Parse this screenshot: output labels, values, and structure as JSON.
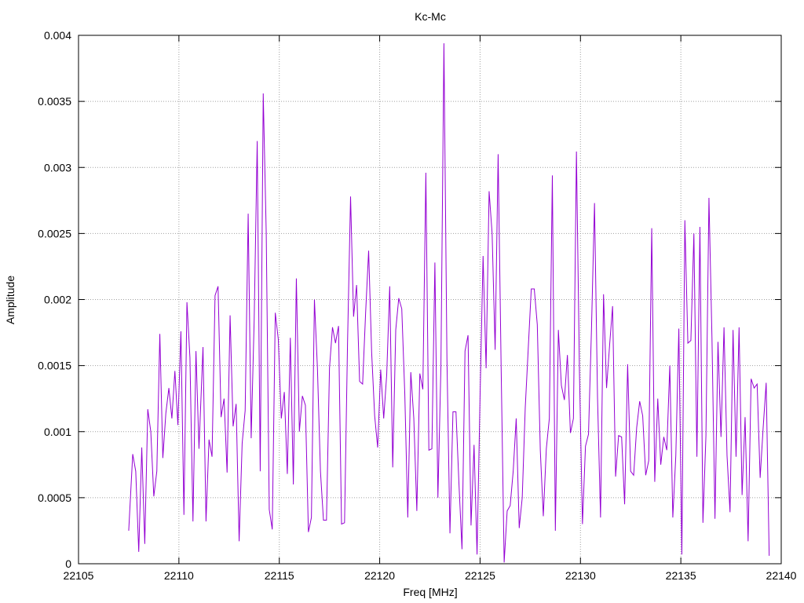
{
  "chart_data": {
    "type": "line",
    "title": "Kc-Mc",
    "xlabel": "Freq [MHz]",
    "ylabel": "Amplitude",
    "xlim": [
      22105,
      22140
    ],
    "ylim": [
      0,
      0.004
    ],
    "grid": true,
    "xticks": [
      22105,
      22110,
      22115,
      22120,
      22125,
      22130,
      22135,
      22140
    ],
    "yticks": [
      0,
      0.0005,
      0.001,
      0.0015,
      0.002,
      0.0025,
      0.003,
      0.0035,
      0.004
    ],
    "xtick_labels": [
      "22105",
      "22110",
      "22115",
      "22120",
      "22125",
      "22130",
      "22135",
      "22140"
    ],
    "ytick_labels": [
      "0",
      "0.0005",
      "0.001",
      "0.0015",
      "0.002",
      "0.0025",
      "0.003",
      "0.0035",
      "0.004"
    ],
    "series_color": "#9400d3",
    "series": [
      {
        "x": [
          22107.5,
          22107.7,
          22107.85,
          22108,
          22108.15,
          22108.3,
          22108.45,
          22108.6,
          22108.75,
          22108.9,
          22109.05,
          22109.2,
          22109.35,
          22109.5,
          22109.65,
          22109.8,
          22109.95,
          22110.1,
          22110.25,
          22110.4,
          22110.55,
          22110.7,
          22110.85,
          22111,
          22111.2,
          22111.35,
          22111.5,
          22111.65,
          22111.8,
          22111.95,
          22112.1,
          22112.25,
          22112.4,
          22112.55,
          22112.7,
          22112.85,
          22113,
          22113.15,
          22113.3,
          22113.45,
          22113.6,
          22113.75,
          22113.9,
          22114.05,
          22114.2,
          22114.35,
          22114.5,
          22114.65,
          22114.8,
          22114.95,
          22115.1,
          22115.25,
          22115.4,
          22115.55,
          22115.7,
          22115.85,
          22116,
          22116.15,
          22116.3,
          22116.45,
          22116.6,
          22116.75,
          22116.9,
          22117.05,
          22117.2,
          22117.35,
          22117.5,
          22117.65,
          22117.8,
          22117.95,
          22118.1,
          22118.25,
          22118.4,
          22118.55,
          22118.7,
          22118.85,
          22119,
          22119.15,
          22119.3,
          22119.45,
          22119.6,
          22119.75,
          22119.9,
          22120.05,
          22120.2,
          22120.35,
          22120.5,
          22120.65,
          22120.8,
          22120.95,
          22121.1,
          22121.25,
          22121.4,
          22121.55,
          22121.7,
          22121.85,
          22122,
          22122.15,
          22122.3,
          22122.45,
          22122.6,
          22122.75,
          22122.9,
          22123.05,
          22123.2,
          22123.35,
          22123.5,
          22123.65,
          22123.8,
          22123.95,
          22124.1,
          22124.25,
          22124.4,
          22124.55,
          22124.7,
          22124.85,
          22125,
          22125.15,
          22125.3,
          22125.45,
          22125.6,
          22125.75,
          22125.9,
          22126.05,
          22126.2,
          22126.35,
          22126.5,
          22126.65,
          22126.8,
          22126.95,
          22127.1,
          22127.25,
          22127.4,
          22127.55,
          22127.7,
          22127.85,
          22128,
          22128.15,
          22128.3,
          22128.45,
          22128.6,
          22128.75,
          22128.9,
          22129.05,
          22129.2,
          22129.35,
          22129.5,
          22129.65,
          22129.8,
          22129.95,
          22130.1,
          22130.25,
          22130.4,
          22130.55,
          22130.7,
          22130.85,
          22131,
          22131.15,
          22131.3,
          22131.45,
          22131.6,
          22131.75,
          22131.9,
          22132.05,
          22132.2,
          22132.35,
          22132.5,
          22132.65,
          22132.8,
          22132.95,
          22133.1,
          22133.25,
          22133.4,
          22133.55,
          22133.7,
          22133.85,
          22134,
          22134.15,
          22134.3,
          22134.45,
          22134.6,
          22134.75,
          22134.9,
          22135.05,
          22135.2,
          22135.35,
          22135.5,
          22135.65,
          22135.8,
          22135.95,
          22136.1,
          22136.25,
          22136.4,
          22136.55,
          22136.7,
          22136.85,
          22137,
          22137.15,
          22137.3,
          22137.45,
          22137.6,
          22137.75,
          22137.9,
          22138.05,
          22138.2,
          22138.35,
          22138.5,
          22138.65,
          22138.8,
          22138.95,
          22139.1,
          22139.25,
          22139.4
        ],
        "values": [
          0.00025,
          0.00083,
          0.0007,
          9e-05,
          0.00088,
          0.00015,
          0.00117,
          0.001,
          0.00051,
          0.0007,
          0.00174,
          0.0008,
          0.00114,
          0.00133,
          0.0011,
          0.00146,
          0.00105,
          0.00176,
          0.00037,
          0.00198,
          0.00156,
          0.00032,
          0.00161,
          0.00087,
          0.00164,
          0.00032,
          0.00094,
          0.00081,
          0.00203,
          0.0021,
          0.00111,
          0.00125,
          0.00069,
          0.00188,
          0.00104,
          0.00121,
          0.00017,
          0.00091,
          0.00116,
          0.00265,
          0.00095,
          0.00185,
          0.0032,
          0.0007,
          0.00356,
          0.0025,
          0.00041,
          0.00026,
          0.0019,
          0.0017,
          0.0011,
          0.0013,
          0.00068,
          0.00171,
          0.0006,
          0.00216,
          0.001,
          0.00127,
          0.0012,
          0.00024,
          0.00035,
          0.002,
          0.00148,
          0.0007,
          0.00033,
          0.00033,
          0.00148,
          0.00179,
          0.00167,
          0.0018,
          0.0003,
          0.00031,
          0.00168,
          0.00278,
          0.00187,
          0.00211,
          0.00138,
          0.00136,
          0.0019,
          0.00237,
          0.0016,
          0.00112,
          0.00088,
          0.00147,
          0.0011,
          0.00143,
          0.0021,
          0.00073,
          0.00177,
          0.00201,
          0.00193,
          0.00129,
          0.00035,
          0.00145,
          0.0011,
          0.0004,
          0.00144,
          0.00132,
          0.00296,
          0.00086,
          0.00087,
          0.00228,
          0.0005,
          0.00149,
          0.00394,
          0.00155,
          0.00023,
          0.00115,
          0.00115,
          0.0006,
          0.00011,
          0.00161,
          0.00173,
          0.00029,
          0.0009,
          7e-05,
          0.00127,
          0.00233,
          0.00148,
          0.00282,
          0.0025,
          0.00162,
          0.0031,
          0.00148,
          1e-05,
          0.0004,
          0.00044,
          0.0007,
          0.0011,
          0.00027,
          0.0005,
          0.00118,
          0.00163,
          0.00208,
          0.00208,
          0.00181,
          0.00086,
          0.00036,
          0.00087,
          0.0011,
          0.00294,
          0.00025,
          0.00177,
          0.00135,
          0.00124,
          0.00158,
          0.00099,
          0.0011,
          0.00312,
          0.00145,
          0.0003,
          0.00089,
          0.00098,
          0.00178,
          0.00273,
          0.00126,
          0.00035,
          0.00204,
          0.00133,
          0.00165,
          0.00195,
          0.00066,
          0.00097,
          0.00096,
          0.00045,
          0.00151,
          0.0007,
          0.00067,
          0.00103,
          0.00123,
          0.00112,
          0.00067,
          0.00078,
          0.00254,
          0.00062,
          0.00125,
          0.00075,
          0.00096,
          0.00086,
          0.0015,
          0.00035,
          0.00082,
          0.00178,
          7e-05,
          0.0026,
          0.00167,
          0.00169,
          0.0025,
          0.00081,
          0.00255,
          0.00031,
          0.00097,
          0.00277,
          0.00171,
          0.00034,
          0.00168,
          0.00096,
          0.00179,
          0.00082,
          0.00039,
          0.00177,
          0.00081,
          0.00179,
          0.00052,
          0.00111,
          0.00017,
          0.0014,
          0.00133,
          0.00136,
          0.00065,
          0.00103,
          0.00137,
          6e-05
        ]
      }
    ]
  }
}
